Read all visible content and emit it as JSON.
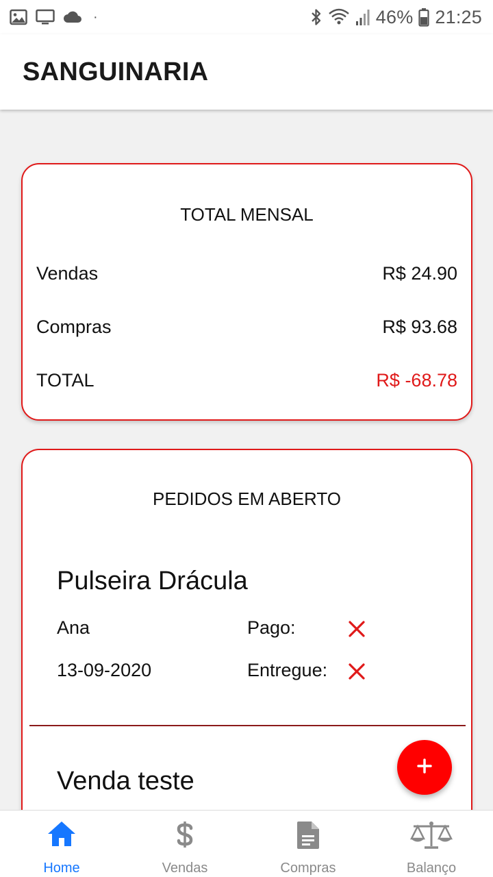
{
  "status_bar": {
    "battery": "46%",
    "time": "21:25",
    "dot": "·",
    "icons": [
      "image-icon",
      "cast-icon",
      "cloud-icon",
      "bluetooth-icon",
      "wifi-icon",
      "signal-icon",
      "battery-icon"
    ]
  },
  "app_bar": {
    "title": "SANGUINARIA"
  },
  "summary": {
    "title": "TOTAL MENSAL",
    "rows": [
      {
        "label": "Vendas",
        "value": "R$ 24.90"
      },
      {
        "label": "Compras",
        "value": "R$ 93.68"
      },
      {
        "label": "TOTAL",
        "value": "R$ -68.78"
      }
    ]
  },
  "orders": {
    "title": "PEDIDOS EM ABERTO",
    "items": [
      {
        "name": "Pulseira Drácula",
        "customer": "Ana",
        "date": "13-09-2020",
        "paid_label": "Pago:",
        "delivered_label": "Entregue:",
        "paid": false,
        "delivered": false
      },
      {
        "name": "Venda teste"
      }
    ]
  },
  "fab": {
    "label": "+",
    "icon": "plus-icon"
  },
  "bottom_nav": {
    "items": [
      {
        "label": "Home",
        "icon": "home-icon",
        "active": true
      },
      {
        "label": "Vendas",
        "icon": "dollar-icon",
        "active": false
      },
      {
        "label": "Compras",
        "icon": "document-icon",
        "active": false
      },
      {
        "label": "Balanço",
        "icon": "scale-icon",
        "active": false
      }
    ]
  },
  "colors": {
    "accent": "#e01919",
    "fab": "#ff0000",
    "nav_active": "#1677ff",
    "nav_inactive": "#8a8a8a",
    "divider": "#8b1a1a"
  }
}
